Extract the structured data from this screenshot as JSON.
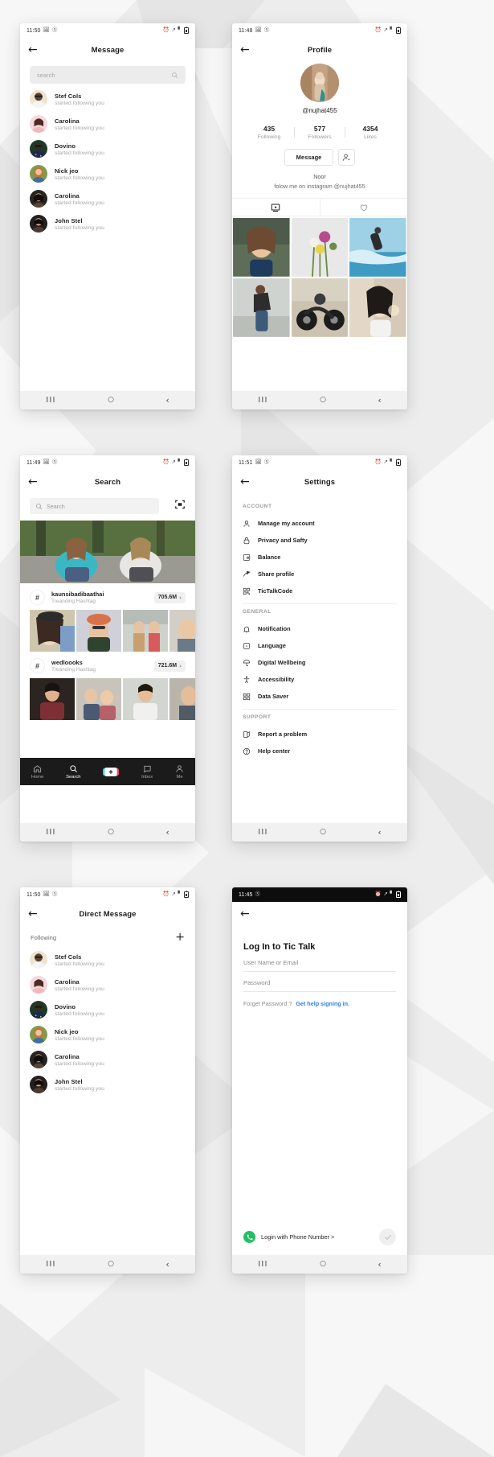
{
  "background": {
    "color": "#eeeeee"
  },
  "screens": {
    "message": {
      "status": {
        "time": "11:50",
        "icons": [
          "image-icon",
          "mute-icon"
        ],
        "right_icons": [
          "alarm-icon",
          "wifi-icon",
          "signal-icon",
          "battery-icon"
        ]
      },
      "title": "Message",
      "back_icon": "back-arrow-icon",
      "search": {
        "placeholder": "search",
        "icon": "search-icon"
      },
      "users": [
        {
          "name": "Stef Cols",
          "sub": "started following you",
          "avatar": "avatar-stef"
        },
        {
          "name": "Carolina",
          "sub": "started following you",
          "avatar": "avatar-carolina-1"
        },
        {
          "name": "Dovino",
          "sub": "started following you",
          "avatar": "avatar-dovino"
        },
        {
          "name": "Nick jeo",
          "sub": "started following you",
          "avatar": "avatar-nick"
        },
        {
          "name": "Carolina",
          "sub": "started following you",
          "avatar": "avatar-carolina-2"
        },
        {
          "name": "John Stel",
          "sub": "started following you",
          "avatar": "avatar-john"
        }
      ]
    },
    "profile": {
      "status": {
        "time": "11:48"
      },
      "title": "Profile",
      "handle": "@nujhat455",
      "stats": [
        {
          "value": "435",
          "label": "Following"
        },
        {
          "value": "577",
          "label": "Followers"
        },
        {
          "value": "4354",
          "label": "Likes"
        }
      ],
      "message_button": "Message",
      "add_friend_icon": "add-person-icon",
      "display_name": "Noor",
      "bio": "folow me on instagram @nujhat455",
      "tabs": [
        {
          "icon": "video-grid-icon",
          "active": true
        },
        {
          "icon": "heart-icon",
          "active": false
        }
      ],
      "photos": [
        "photo-portrait-1",
        "photo-flowers",
        "photo-surf",
        "photo-dance",
        "photo-motorbike",
        "photo-girl-bubble"
      ]
    },
    "search": {
      "status": {
        "time": "11:49"
      },
      "title": "Search",
      "search": {
        "placeholder": "Search",
        "icon": "search-icon",
        "scan_icon": "scan-icon"
      },
      "hero_image": "photo-two-girls",
      "hashtags": [
        {
          "name": "kaunsibadibaathai",
          "sub": "Treanding Hashtag",
          "count": "705.6M",
          "chevron": "›",
          "thumbs": [
            "thumb-hat-girl",
            "thumb-bucket-hat",
            "thumb-two-women",
            "thumb-partial"
          ]
        },
        {
          "name": "wedloooks",
          "sub": "Treanding Hashtag",
          "count": "721.6M",
          "chevron": "›",
          "thumbs": [
            "thumb-man-maroon",
            "thumb-couple",
            "thumb-man-white",
            "thumb-partial2"
          ]
        }
      ],
      "tabbar": [
        {
          "label": "Home",
          "icon": "home-icon",
          "active": false
        },
        {
          "label": "Search",
          "icon": "search-icon",
          "active": true
        },
        {
          "label": "",
          "icon": "add-post-icon",
          "active": false
        },
        {
          "label": "Inbox",
          "icon": "inbox-icon",
          "active": false
        },
        {
          "label": "Me",
          "icon": "person-icon",
          "active": false
        }
      ]
    },
    "settings": {
      "status": {
        "time": "11:51"
      },
      "title": "Settings",
      "sections": [
        {
          "heading": "ACCOUNT",
          "items": [
            {
              "label": "Manage my account",
              "icon": "person-icon"
            },
            {
              "label": "Privacy and Safty",
              "icon": "lock-icon"
            },
            {
              "label": "Balance",
              "icon": "wallet-icon"
            },
            {
              "label": "Share profile",
              "icon": "share-icon"
            },
            {
              "label": "TicTalkCode",
              "icon": "qr-code-icon"
            }
          ]
        },
        {
          "heading": "GENERAL",
          "items": [
            {
              "label": "Notification",
              "icon": "bell-icon"
            },
            {
              "label": "Language",
              "icon": "language-icon"
            },
            {
              "label": "Digital Wellbeing",
              "icon": "umbrella-icon"
            },
            {
              "label": "Accessibility",
              "icon": "accessibility-icon"
            },
            {
              "label": "Data Saver",
              "icon": "data-saver-icon"
            }
          ]
        },
        {
          "heading": "SUPPORT",
          "items": [
            {
              "label": "Report a problem",
              "icon": "report-icon"
            },
            {
              "label": "Help center",
              "icon": "help-icon"
            }
          ]
        }
      ]
    },
    "direct_message": {
      "status": {
        "time": "11:50"
      },
      "title": "Direct Message",
      "following_label": "Following",
      "add_icon": "plus-icon",
      "users": [
        {
          "name": "Stef Cols",
          "sub": "started following you",
          "avatar": "avatar-stef"
        },
        {
          "name": "Carolina",
          "sub": "started following you",
          "avatar": "avatar-carolina-1"
        },
        {
          "name": "Dovino",
          "sub": "started following you",
          "avatar": "avatar-dovino"
        },
        {
          "name": "Nick jeo",
          "sub": "started following you",
          "avatar": "avatar-nick"
        },
        {
          "name": "Carolina",
          "sub": "started following you",
          "avatar": "avatar-carolina-2"
        },
        {
          "name": "John Stel",
          "sub": "started following you",
          "avatar": "avatar-john"
        }
      ]
    },
    "login": {
      "status": {
        "time": "11:45",
        "dark": true
      },
      "title": "Log In to Tic Talk",
      "fields": [
        {
          "placeholder": "User Name or Email"
        },
        {
          "placeholder": "Password"
        }
      ],
      "forgot_text": "Forget Password ?",
      "help_link": "Get help signing in.",
      "phone_login": "Login with Phone Number >",
      "phone_icon": "phone-icon",
      "submit_icon": "check-icon",
      "accent_color": "#2f80ed",
      "phone_badge_color": "#21c063"
    }
  },
  "navbar": {
    "recent": "III",
    "home": "○",
    "back": "‹"
  }
}
